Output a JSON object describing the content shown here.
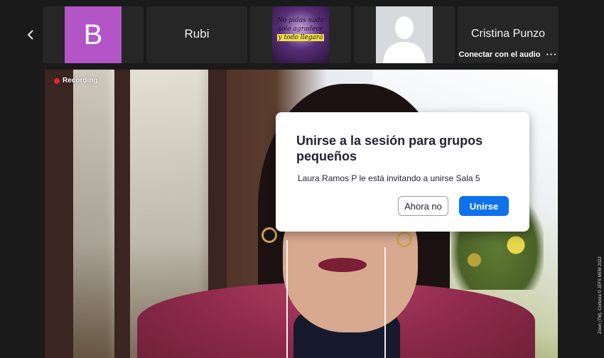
{
  "participants": [
    {
      "type": "letter-avatar",
      "letter": "B",
      "color": "#b355c7"
    },
    {
      "type": "name-only",
      "name": "Rubi"
    },
    {
      "type": "image",
      "image_text": [
        "No pidas nada",
        "solo agradece",
        "y todo llegará"
      ]
    },
    {
      "type": "silhouette"
    },
    {
      "type": "name-with-status",
      "name": "Cristina Punzo",
      "status": "Conectar con el audio",
      "more": "···"
    }
  ],
  "main_video": {
    "recording_label": "Recording"
  },
  "dialog": {
    "title": "Unirse a la sesión para grupos pequeños",
    "message": "Laura Ramos P le está invitando a unirse Sala 5",
    "secondary_button": "Ahora no",
    "primary_button": "Unirse"
  },
  "watermark": "Zoom (TM). Cortesía © JEFS MEM 2022",
  "colors": {
    "primary": "#0e72ed",
    "recording": "#e02828",
    "avatar": "#b355c7",
    "background": "#1a1a1a"
  }
}
